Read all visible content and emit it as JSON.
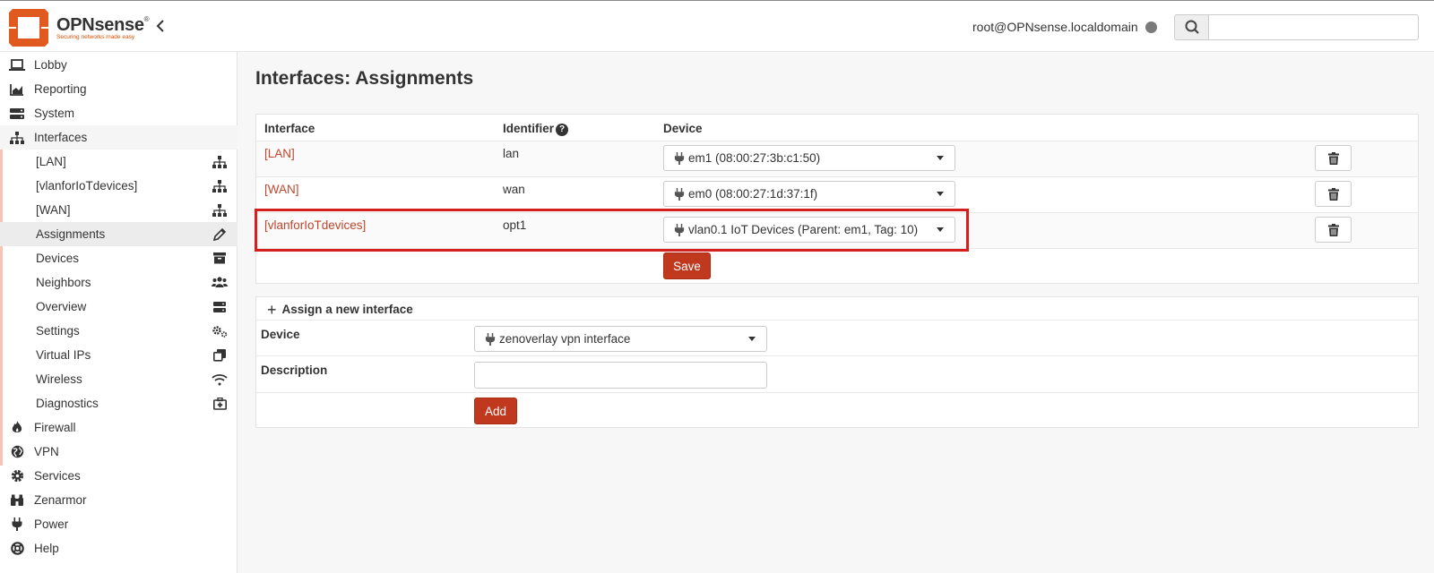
{
  "header": {
    "brand_name": "OPNsense",
    "brand_reg": "®",
    "brand_tagline": "Securing networks made easy",
    "user": "root@OPNsense.localdomain",
    "search_placeholder": ""
  },
  "sidebar": {
    "top_items": [
      {
        "label": "Lobby",
        "icon": "laptop-icon"
      },
      {
        "label": "Reporting",
        "icon": "area-chart-icon"
      },
      {
        "label": "System",
        "icon": "server-icon"
      },
      {
        "label": "Interfaces",
        "icon": "sitemap-icon"
      }
    ],
    "interfaces_sub": [
      {
        "label": "[LAN]",
        "icon": "sitemap-icon"
      },
      {
        "label": "[vlanforIoTdevices]",
        "icon": "sitemap-icon"
      },
      {
        "label": "[WAN]",
        "icon": "sitemap-icon"
      },
      {
        "label": "Assignments",
        "icon": "pencil-icon",
        "active": true
      },
      {
        "label": "Devices",
        "icon": "archive-icon"
      },
      {
        "label": "Neighbors",
        "icon": "users-icon"
      },
      {
        "label": "Overview",
        "icon": "server-icon"
      },
      {
        "label": "Settings",
        "icon": "cogs-icon"
      },
      {
        "label": "Virtual IPs",
        "icon": "clone-icon"
      },
      {
        "label": "Wireless",
        "icon": "wifi-icon"
      },
      {
        "label": "Diagnostics",
        "icon": "medkit-icon"
      }
    ],
    "bottom_items": [
      {
        "label": "Firewall",
        "icon": "fire-icon"
      },
      {
        "label": "VPN",
        "icon": "globe-icon"
      },
      {
        "label": "Services",
        "icon": "cog-icon"
      },
      {
        "label": "Zenarmor",
        "icon": "binoculars-icon"
      },
      {
        "label": "Power",
        "icon": "plug-icon"
      },
      {
        "label": "Help",
        "icon": "life-ring-icon"
      }
    ]
  },
  "main": {
    "title": "Interfaces: Assignments",
    "table": {
      "headers": {
        "interface": "Interface",
        "identifier": "Identifier",
        "device": "Device"
      },
      "help_glyph": "?",
      "rows": [
        {
          "interface": "[LAN]",
          "identifier": "lan",
          "device": "em1 (08:00:27:3b:c1:50)"
        },
        {
          "interface": "[WAN]",
          "identifier": "wan",
          "device": "em0 (08:00:27:1d:37:1f)"
        },
        {
          "interface": "[vlanforIoTdevices]",
          "identifier": "opt1",
          "device": "vlan0.1 IoT Devices (Parent: em1, Tag: 10)"
        }
      ],
      "save_label": "Save"
    },
    "assign": {
      "title": "Assign a new interface",
      "plus_glyph": "+",
      "device_label": "Device",
      "device_value": "zenoverlay vpn interface",
      "description_label": "Description",
      "description_value": "",
      "add_label": "Add"
    }
  },
  "colors": {
    "accent": "#c0391e",
    "link": "#c0462d",
    "highlight_box": "#d41f1f"
  }
}
